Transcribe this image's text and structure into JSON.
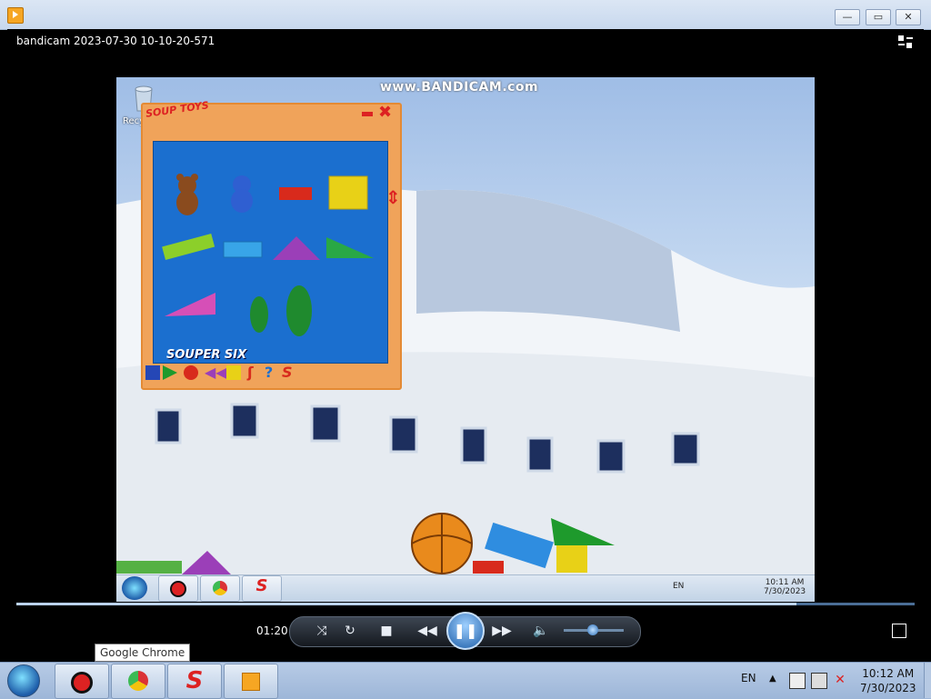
{
  "window": {
    "minimize_icon": "minimize-icon",
    "restore_icon": "restore-icon",
    "close_icon": "close-icon"
  },
  "player": {
    "file_name": "bandicam 2023-07-30 10-10-20-571",
    "time": "01:20",
    "progress": 0.87,
    "volume": 0.5
  },
  "video": {
    "watermark": "www.BANDICAM.com",
    "desktop_icon_label": "Recy",
    "toys_window": {
      "logo": "SOUP TOYS",
      "group_label": "SOUPER SIX"
    },
    "taskbar": {
      "lang": "EN",
      "time": "10:11 AM",
      "date": "7/30/2023"
    }
  },
  "tooltip": "Google Chrome",
  "taskbar": {
    "lang": "EN",
    "time": "10:12 AM",
    "date": "7/30/2023"
  }
}
